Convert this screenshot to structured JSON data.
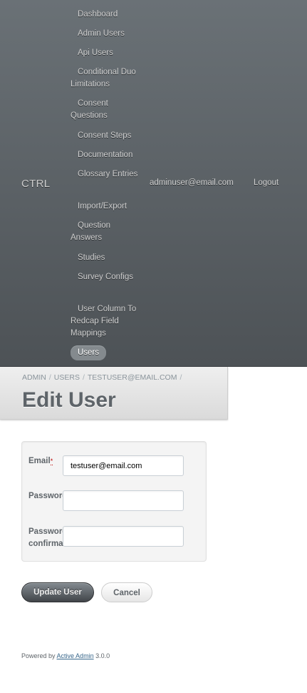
{
  "header": {
    "site_title": "CTRL",
    "nav": [
      "Dashboard",
      "Admin Users",
      "Api Users",
      "Conditional Duo Limitations",
      "Consent Questions",
      "Consent Steps",
      "Documentation",
      "Glossary Entries",
      "Import/Export",
      "Question Answers",
      "Studies",
      "Survey Configs",
      "User Column To Redcap Field Mappings",
      "Users"
    ],
    "current_user": "adminuser@email.com",
    "logout": "Logout"
  },
  "title_bar": {
    "breadcrumb": [
      "ADMIN",
      "USERS",
      "TESTUSER@EMAIL.COM"
    ],
    "separator": "/",
    "title": "Edit User"
  },
  "form": {
    "email_label": "Email",
    "required_mark": "*",
    "email_value": "testuser@email.com",
    "password_label": "Password",
    "password_confirmation_label": "Password confirmation",
    "submit_label": "Update User",
    "cancel_label": "Cancel"
  },
  "footer": {
    "prefix": "Powered by",
    "link": "Active Admin",
    "version": "3.0.0"
  }
}
